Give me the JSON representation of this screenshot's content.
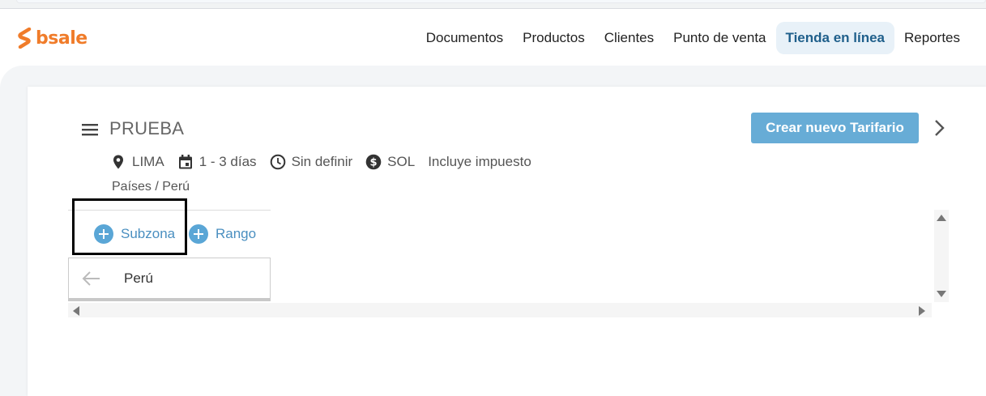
{
  "brand": {
    "name": "bsale",
    "color": "#f07c2a"
  },
  "nav": {
    "items": [
      {
        "label": "Documentos",
        "active": false
      },
      {
        "label": "Productos",
        "active": false
      },
      {
        "label": "Clientes",
        "active": false
      },
      {
        "label": "Punto de venta",
        "active": false
      },
      {
        "label": "Tienda en línea",
        "active": true
      },
      {
        "label": "Reportes",
        "active": false
      }
    ]
  },
  "tariff": {
    "title": "PRUEBA",
    "create_button_label": "Crear nuevo Tarifario",
    "meta": {
      "location": "LIMA",
      "delivery_time": "1 - 3 días",
      "schedule": "Sin definir",
      "currency": "SOL",
      "tax_note": "Incluye impuesto"
    },
    "breadcrumb": "Países / Perú"
  },
  "toolbar": {
    "subzona_label": "Subzona",
    "rango_label": "Rango"
  },
  "zone": {
    "label": "Perú"
  },
  "icons": {
    "menu": "hamburger-menu-icon",
    "chevron": "chevron-right-icon",
    "location": "map-pin-icon",
    "calendar": "calendar-icon",
    "clock": "clock-icon",
    "currency": "dollar-circle-icon",
    "back": "arrow-left-icon",
    "add": "plus-circle-icon"
  },
  "colors": {
    "accent": "#67acd6",
    "active_nav_bg": "#e8f1f8",
    "active_nav_text": "#1f5f8b",
    "link": "#4a8fc0"
  }
}
